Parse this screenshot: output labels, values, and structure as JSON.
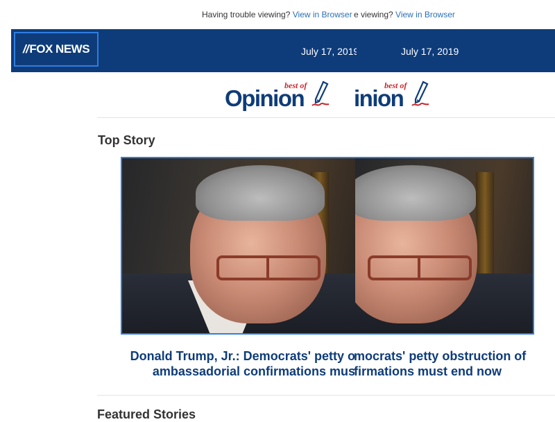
{
  "banner": {
    "trouble_text": "Having trouble viewing?",
    "view_link": "View in Browser",
    "trouble_text_dup": "e viewing?",
    "view_link_dup": "View in Browser"
  },
  "header": {
    "logo_text": "FOX NEWS",
    "date": "July 17, 2019",
    "date_dup": "July 17, 2019"
  },
  "masthead": {
    "best_of": "best of",
    "word": "Opinion",
    "word_dup": "inion"
  },
  "top_story": {
    "section_title": "Top Story",
    "headline_line1": "Donald Trump, Jr.: Democrats' petty o",
    "headline_line1_dup": "mocrats' petty obstruction of",
    "headline_line2": "ambassadorial confirmations mus",
    "headline_line2_dup": "firmations must end now"
  },
  "featured": {
    "section_title": "Featured Stories"
  },
  "colors": {
    "navy": "#0e3c7a",
    "accent_border": "#2f7de1",
    "link_blue": "#2a6fb7",
    "best_of_red": "#c8272e"
  }
}
